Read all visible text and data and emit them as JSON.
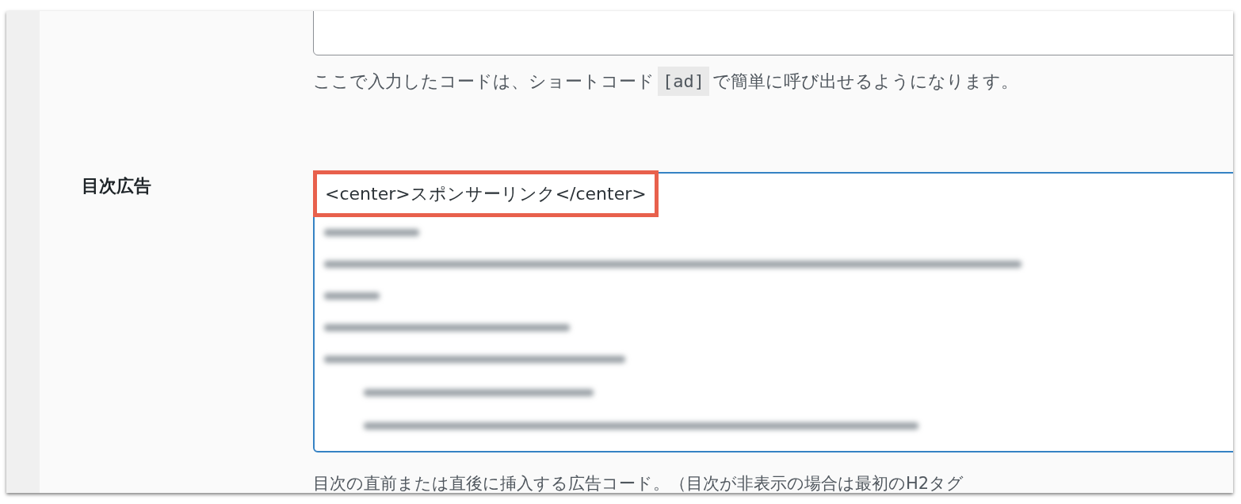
{
  "previous_field": {
    "help_parts": [
      {
        "kind": "text",
        "text": "ここで入力したコードは、ショートコード"
      },
      {
        "kind": "code",
        "text": "[ad]"
      },
      {
        "kind": "text",
        "text": "で簡単に呼び出せるようになります。"
      }
    ]
  },
  "toc_ad_field": {
    "label": "目次広告",
    "first_line": "<center>スポンサーリンク</center>",
    "first_line_highlighted": true,
    "focused": true,
    "help": "目次の直前または直後に挿入する広告コード。（目次が非表示の場合は最初のH2タグ"
  }
}
